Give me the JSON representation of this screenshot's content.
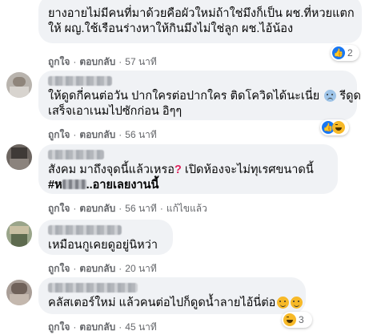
{
  "comments": [
    {
      "lines": [
        "ยางอายไม่มีคนที่มาด้วยคือผัวใหม่ถ้าใช่มึงก็เป็น ผช.ที่หวยแตก",
        "ให้ ผญ.ใช้เรือนร่างหาให้กินมึงไม่ใช่ลูก ผช.ไอ้น้อง"
      ],
      "like": "ถูกใจ",
      "reply": "ตอบกลับ",
      "time": "57 นาที",
      "reactions": [
        "like-icon"
      ],
      "reaction_count": "2"
    },
    {
      "lines": [
        "ให้ดูดกี่คนต่อวัน ปากใครต่อปากใคร ติดโควิดได้นะเนี่ย",
        "เสร็จเอาเนมไปซักก่อน อิๆๆ"
      ],
      "line1_tail": "รีดูด",
      "like": "ถูกใจ",
      "reply": "ตอบกลับ",
      "time": "56 นาที",
      "reactions": [
        "like-icon",
        "laugh-icon"
      ],
      "reaction_count": ""
    },
    {
      "line1": "สังคม มาถึงจุดนี้แล้วเหรอ",
      "line1_tail": "เปิดห้องจะไม่ทุเรศขนาดนี้",
      "hashtag_start": "#ห",
      "hashtag_end": "..อายเลยงานนี้",
      "like": "ถูกใจ",
      "reply": "ตอบกลับ",
      "time": "56 นาที",
      "edited": "แก้ไขแล้ว"
    },
    {
      "lines": [
        "เหมือนกูเคยดูอยู่นิหว่า"
      ],
      "like": "ถูกใจ",
      "reply": "ตอบกลับ",
      "time": "20 นาที"
    },
    {
      "lines": [
        "คลัสเตอร์ใหม่ แล้วคนต่อไปก็ดูดน้ำลายไอ้นี่ต่อ"
      ],
      "like": "ถูกใจ",
      "reply": "ตอบกลับ",
      "time": "45 นาที",
      "reactions": [
        "laugh-icon",
        "laugh-icon"
      ],
      "reaction_count": "3"
    }
  ]
}
